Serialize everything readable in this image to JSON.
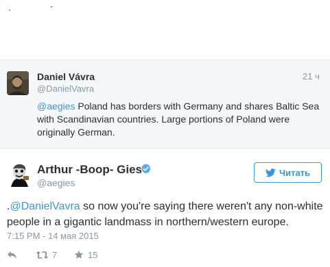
{
  "colors": {
    "link": "#3b94d9",
    "muted": "#8899a6",
    "text": "#292f33",
    "quoted_bg": "#f5f8fa"
  },
  "quoted_tweet": {
    "author_name": "Daniel Vávra",
    "handle": "@DanielVavra",
    "time": "21 ч",
    "text": {
      "mention": "@aegies",
      "body": " Poland has borders with Germany and shares Baltic Sea with Scandinavian countries. Large portions of Poland were originally German."
    }
  },
  "main_tweet": {
    "author_name": "Arthur -Boop- Gies",
    "verified_icon": "verified-badge-icon",
    "handle": "@aegies",
    "follow_button": {
      "icon": "twitter-bird-icon",
      "label": "Читать"
    },
    "text": {
      "prefix": ".",
      "mention": "@DanielVavra",
      "body": " so now you're saying there weren't any non-white people in a gigantic landmass in northern/western europe."
    },
    "timestamp": "7:15 PM - 14 мая 2015",
    "actions": {
      "reply_icon": "reply-icon",
      "retweet_icon": "retweet-icon",
      "retweet_count": "7",
      "favorite_icon": "star-icon",
      "favorite_count": "15"
    }
  }
}
